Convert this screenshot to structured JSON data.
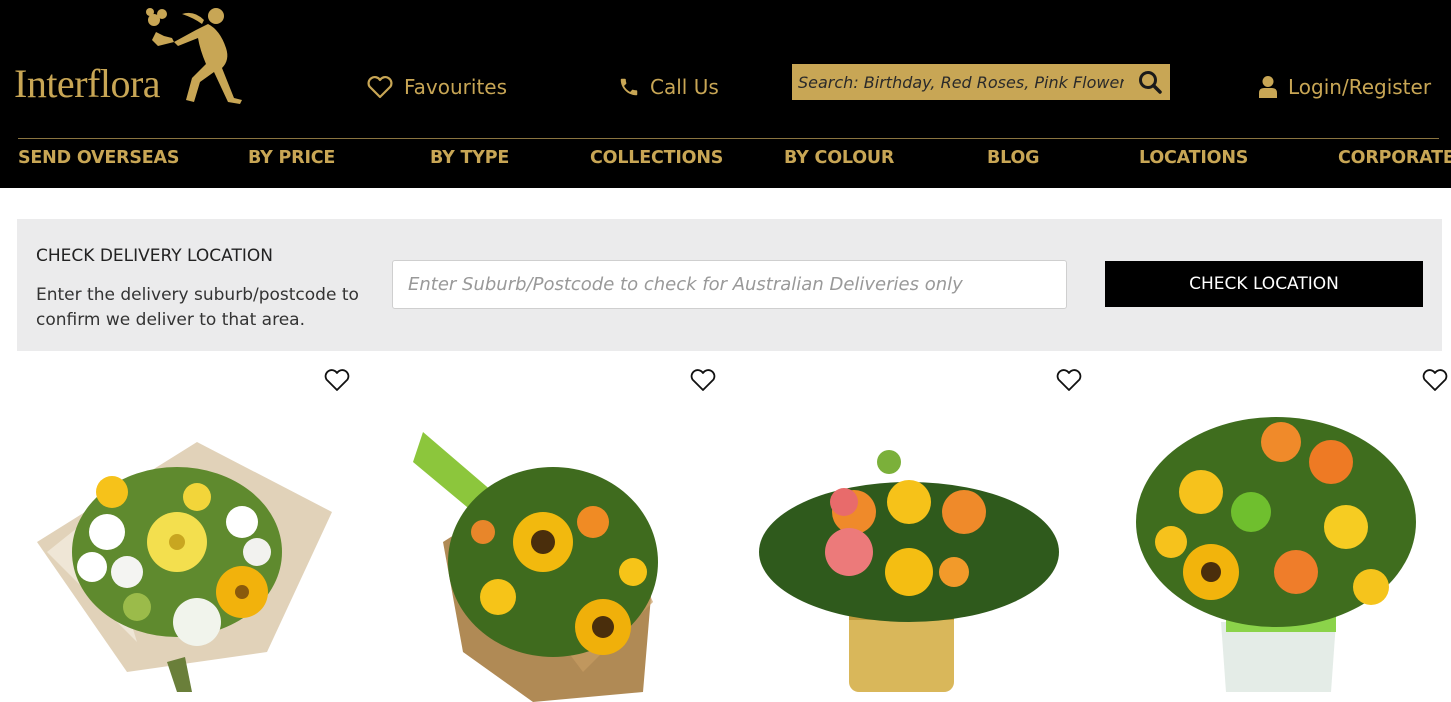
{
  "brand": {
    "name": "Interflora"
  },
  "header": {
    "favourites_label": "Favourites",
    "call_label": "Call Us",
    "login_label": "Login/Register",
    "search": {
      "placeholder": "Search: Birthday, Red Roses, Pink Flowers"
    }
  },
  "nav": {
    "items": [
      "SEND OVERSEAS",
      "BY PRICE",
      "BY TYPE",
      "COLLECTIONS",
      "BY COLOUR",
      "BLOG",
      "LOCATIONS",
      "CORPORATE"
    ]
  },
  "delivery": {
    "title": "CHECK DELIVERY LOCATION",
    "description": "Enter the delivery suburb/postcode to confirm we deliver to that area.",
    "input_placeholder": "Enter Suburb/Postcode to check for Australian Deliveries only",
    "button_label": "CHECK LOCATION"
  },
  "products": [
    {
      "image": "yellow-white-lily-bouquet"
    },
    {
      "image": "sunflower-burlap-bouquet"
    },
    {
      "image": "orange-roses-gold-pot-arrangement"
    },
    {
      "image": "sunflower-orange-rose-vase-arrangement"
    }
  ],
  "colors": {
    "gold": "#c8a655",
    "black": "#000000",
    "panel": "#ebebec"
  },
  "icons": [
    "heart-icon",
    "phone-icon",
    "search-icon",
    "user-icon"
  ]
}
